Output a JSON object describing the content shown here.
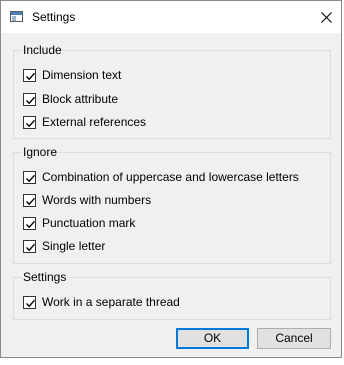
{
  "window": {
    "title": "Settings",
    "icon": "window-icon",
    "close_icon": "close-icon"
  },
  "groups": [
    {
      "label": "Include",
      "items": [
        {
          "label": "Dimension text",
          "checked": true
        },
        {
          "label": "Block attribute",
          "checked": true
        },
        {
          "label": "External references",
          "checked": true
        }
      ]
    },
    {
      "label": "Ignore",
      "items": [
        {
          "label": "Combination of uppercase and lowercase letters",
          "checked": true
        },
        {
          "label": "Words with numbers",
          "checked": true
        },
        {
          "label": "Punctuation mark",
          "checked": true
        },
        {
          "label": "Single letter",
          "checked": true
        }
      ]
    },
    {
      "label": "Settings",
      "items": [
        {
          "label": "Work in a separate thread",
          "checked": true
        }
      ]
    }
  ],
  "buttons": {
    "ok_label": "OK",
    "cancel_label": "Cancel"
  },
  "colors": {
    "dialog_bg": "#f0f0f0",
    "accent": "#0078d7"
  }
}
